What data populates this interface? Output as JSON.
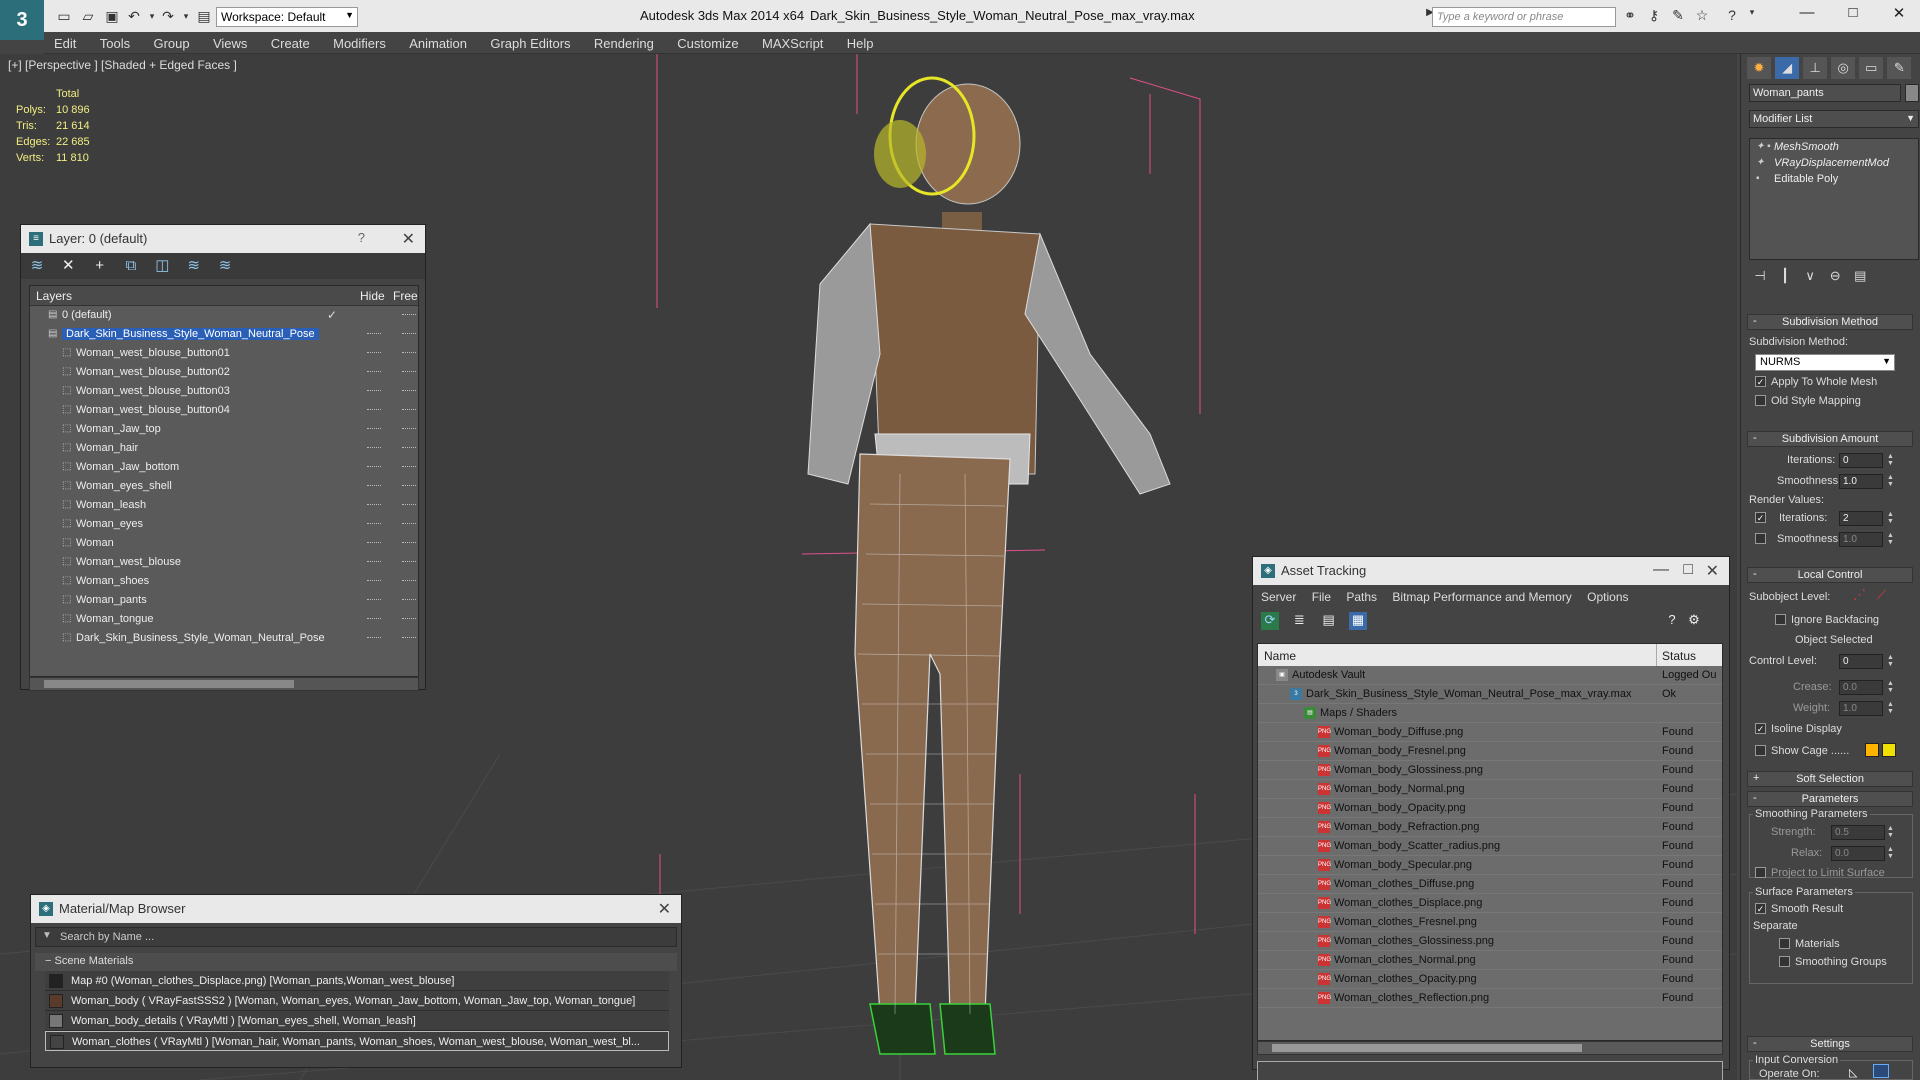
{
  "title": {
    "app_name": "Autodesk 3ds Max  2014 x64",
    "file_name": "Dark_Skin_Business_Style_Woman_Neutral_Pose_max_vray.max",
    "workspace": "Workspace: Default",
    "search_placeholder": "Type a keyword or phrase"
  },
  "menu": [
    "Edit",
    "Tools",
    "Group",
    "Views",
    "Create",
    "Modifiers",
    "Animation",
    "Graph Editors",
    "Rendering",
    "Customize",
    "MAXScript",
    "Help"
  ],
  "viewport": {
    "label": "[+] [Perspective ] [Shaded + Edged Faces ]",
    "stats": {
      "header": "Total",
      "polys_label": "Polys:",
      "polys": "10 896",
      "tris_label": "Tris:",
      "tris": "21 614",
      "edges_label": "Edges:",
      "edges": "22 685",
      "verts_label": "Verts:",
      "verts": "11 810"
    }
  },
  "layer_window": {
    "title": "Layer: 0 (default)",
    "help": "?",
    "columns": {
      "layers": "Layers",
      "hide": "Hide",
      "freeze": "Freeze"
    },
    "rows": [
      {
        "name": "0 (default)",
        "level": 0
      },
      {
        "name": "Dark_Skin_Business_Style_Woman_Neutral_Pose",
        "level": 0
      },
      {
        "name": "Woman_west_blouse_button01",
        "level": 1
      },
      {
        "name": "Woman_west_blouse_button02",
        "level": 1
      },
      {
        "name": "Woman_west_blouse_button03",
        "level": 1
      },
      {
        "name": "Woman_west_blouse_button04",
        "level": 1
      },
      {
        "name": "Woman_Jaw_top",
        "level": 1
      },
      {
        "name": "Woman_hair",
        "level": 1
      },
      {
        "name": "Woman_Jaw_bottom",
        "level": 1
      },
      {
        "name": "Woman_eyes_shell",
        "level": 1
      },
      {
        "name": "Woman_leash",
        "level": 1
      },
      {
        "name": "Woman_eyes",
        "level": 1
      },
      {
        "name": "Woman",
        "level": 1
      },
      {
        "name": "Woman_west_blouse",
        "level": 1
      },
      {
        "name": "Woman_shoes",
        "level": 1
      },
      {
        "name": "Woman_pants",
        "level": 1
      },
      {
        "name": "Woman_tongue",
        "level": 1
      },
      {
        "name": "Dark_Skin_Business_Style_Woman_Neutral_Pose",
        "level": 1
      }
    ]
  },
  "material_browser": {
    "title": "Material/Map Browser",
    "search_placeholder": "Search by Name ...",
    "section": "Scene Materials",
    "rows": [
      "Map #0 (Woman_clothes_Displace.png) [Woman_pants,Woman_west_blouse]",
      "Woman_body  ( VRayFastSSS2 ) [Woman, Woman_eyes, Woman_Jaw_bottom, Woman_Jaw_top, Woman_tongue]",
      "Woman_body_details  ( VRayMtl ) [Woman_eyes_shell, Woman_leash]",
      "Woman_clothes  ( VRayMtl ) [Woman_hair, Woman_pants, Woman_shoes, Woman_west_blouse, Woman_west_bl..."
    ]
  },
  "asset_tracking": {
    "title": "Asset Tracking",
    "menu": [
      "Server",
      "File",
      "Paths",
      "Bitmap Performance and Memory",
      "Options"
    ],
    "columns": {
      "name": "Name",
      "status": "Status"
    },
    "rows": [
      {
        "name": "Autodesk Vault",
        "status": "Logged Ou",
        "level": 0,
        "icon": "vault"
      },
      {
        "name": "Dark_Skin_Business_Style_Woman_Neutral_Pose_max_vray.max",
        "status": "Ok",
        "level": 1,
        "icon": "max"
      },
      {
        "name": "Maps / Shaders",
        "status": "",
        "level": 2,
        "icon": "folder"
      },
      {
        "name": "Woman_body_Diffuse.png",
        "status": "Found",
        "level": 3,
        "icon": "png"
      },
      {
        "name": "Woman_body_Fresnel.png",
        "status": "Found",
        "level": 3,
        "icon": "png"
      },
      {
        "name": "Woman_body_Glossiness.png",
        "status": "Found",
        "level": 3,
        "icon": "png"
      },
      {
        "name": "Woman_body_Normal.png",
        "status": "Found",
        "level": 3,
        "icon": "png"
      },
      {
        "name": "Woman_body_Opacity.png",
        "status": "Found",
        "level": 3,
        "icon": "png"
      },
      {
        "name": "Woman_body_Refraction.png",
        "status": "Found",
        "level": 3,
        "icon": "png"
      },
      {
        "name": "Woman_body_Scatter_radius.png",
        "status": "Found",
        "level": 3,
        "icon": "png"
      },
      {
        "name": "Woman_body_Specular.png",
        "status": "Found",
        "level": 3,
        "icon": "png"
      },
      {
        "name": "Woman_clothes_Diffuse.png",
        "status": "Found",
        "level": 3,
        "icon": "png"
      },
      {
        "name": "Woman_clothes_Displace.png",
        "status": "Found",
        "level": 3,
        "icon": "png"
      },
      {
        "name": "Woman_clothes_Fresnel.png",
        "status": "Found",
        "level": 3,
        "icon": "png"
      },
      {
        "name": "Woman_clothes_Glossiness.png",
        "status": "Found",
        "level": 3,
        "icon": "png"
      },
      {
        "name": "Woman_clothes_Normal.png",
        "status": "Found",
        "level": 3,
        "icon": "png"
      },
      {
        "name": "Woman_clothes_Opacity.png",
        "status": "Found",
        "level": 3,
        "icon": "png"
      },
      {
        "name": "Woman_clothes_Reflection.png",
        "status": "Found",
        "level": 3,
        "icon": "png"
      }
    ]
  },
  "command_panel": {
    "object_name": "Woman_pants",
    "modifier_list": "Modifier List",
    "stack": [
      "MeshSmooth",
      "VRayDisplacementMod",
      "Editable Poly"
    ],
    "subdivision_method": {
      "rollout": "Subdivision Method",
      "label": "Subdivision Method:",
      "value": "NURMS",
      "apply_whole_mesh": "Apply To Whole Mesh",
      "old_style": "Old Style Mapping"
    },
    "subdivision_amount": {
      "rollout": "Subdivision Amount",
      "iterations_label": "Iterations:",
      "iterations": "0",
      "smoothness_label": "Smoothness:",
      "smoothness": "1.0",
      "render_values": "Render Values:",
      "r_iterations_label": "Iterations:",
      "r_iterations": "2",
      "r_smoothness_label": "Smoothness:",
      "r_smoothness": "1.0"
    },
    "local_control": {
      "rollout": "Local Control",
      "subobject_label": "Subobject Level:",
      "ignore_backfacing": "Ignore Backfacing",
      "object_selected": "Object Selected",
      "control_level_label": "Control Level:",
      "control_level": "0",
      "crease_label": "Crease:",
      "crease": "0.0",
      "weight_label": "Weight:",
      "weight": "1.0",
      "isoline": "Isoline Display",
      "show_cage": "Show Cage ......",
      "cage_color_1": "#ffb400",
      "cage_color_2": "#f0e000"
    },
    "soft_selection": "Soft Selection",
    "parameters": {
      "rollout": "Parameters",
      "smoothing_group": "Smoothing Parameters",
      "strength_label": "Strength:",
      "strength": "0.5",
      "relax_label": "Relax:",
      "relax": "0.0",
      "project": "Project to Limit Surface",
      "surface_group": "Surface Parameters",
      "smooth_result": "Smooth Result",
      "separate": "Separate",
      "materials": "Materials",
      "smoothing_groups": "Smoothing Groups"
    },
    "settings": {
      "rollout": "Settings",
      "input_conversion": "Input Conversion",
      "operate_on": "Operate On:"
    }
  }
}
